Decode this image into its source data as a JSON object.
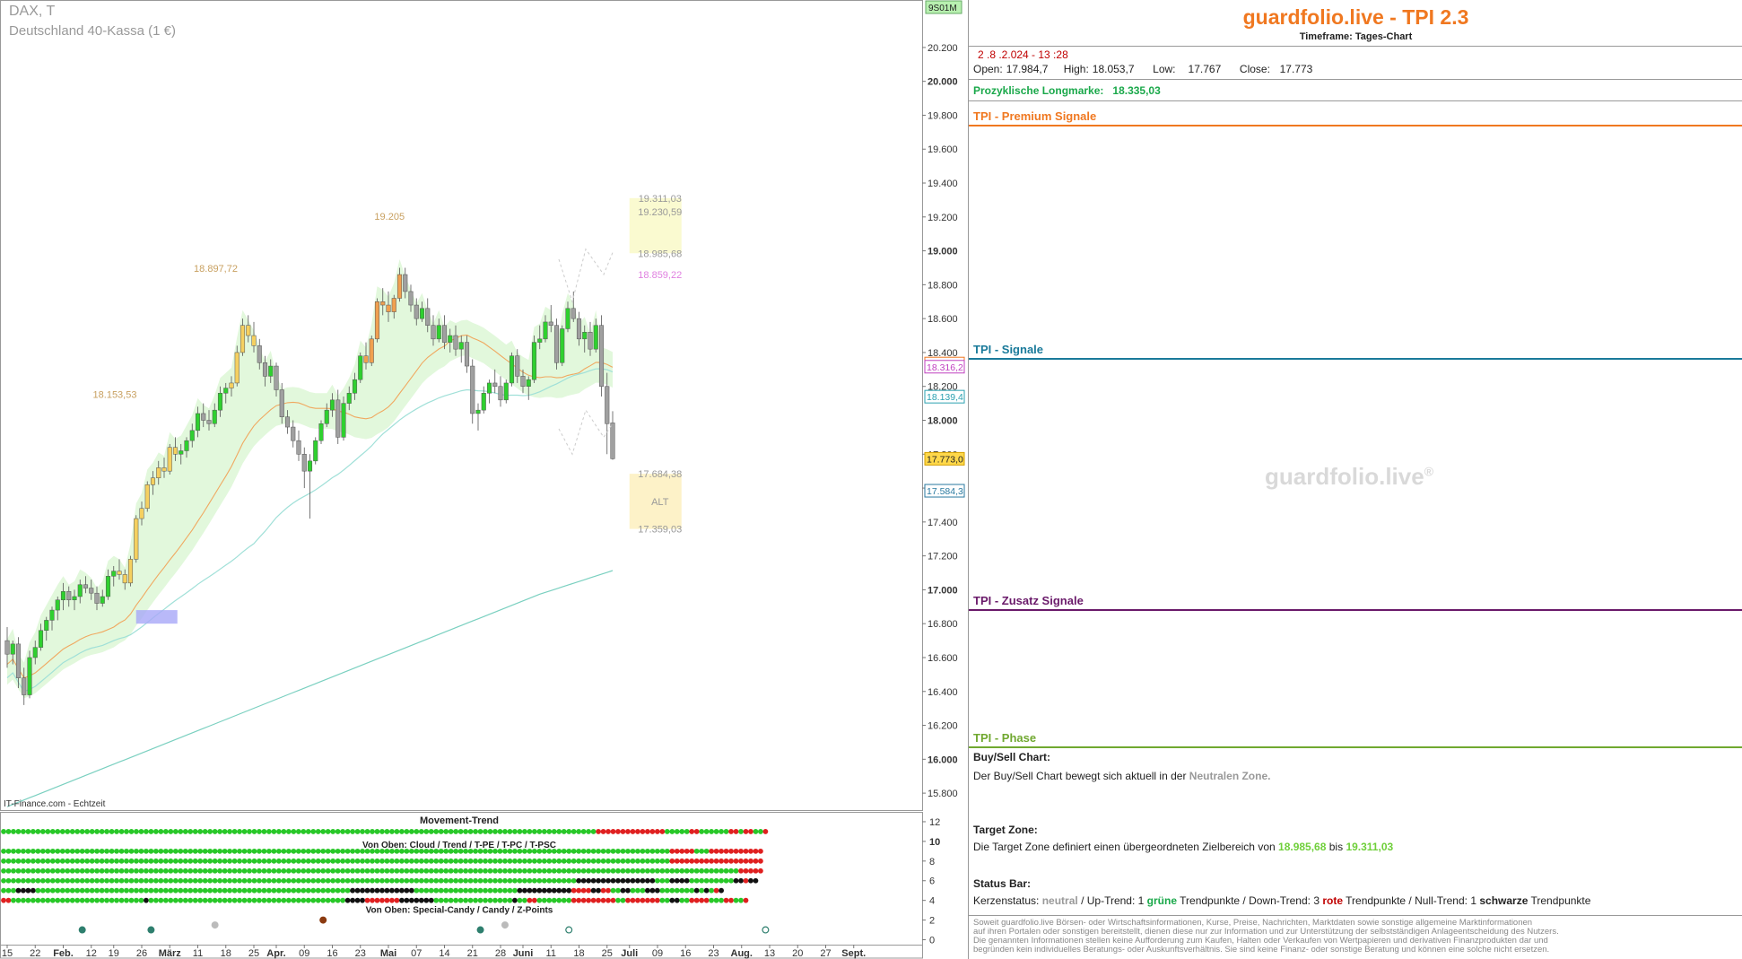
{
  "header": {
    "symbol": "DAX, T",
    "name": "Deutschland 40-Kassa (1 €)"
  },
  "source": "IT-Finance.com - Echtzeit",
  "watermark": "guardfolio.live",
  "watermark_reg": "®",
  "toolbar_label": "9S01M",
  "chart_data": [
    {
      "type": "candlestick",
      "y_axis": {
        "min": 15700,
        "max": 20480,
        "side": "right",
        "ticks": [
          "20.200",
          "20.000",
          "19.800",
          "19.600",
          "19.400",
          "19.200",
          "19.000",
          "18.800",
          "18.600",
          "18.400",
          "18.200",
          "18.000",
          "17.800",
          "17.600",
          "17.400",
          "17.200",
          "17.000",
          "16.800",
          "16.600",
          "16.400",
          "16.200",
          "16.000",
          "15.800"
        ],
        "tick_values": [
          20200,
          20000,
          19800,
          19600,
          19400,
          19200,
          19000,
          18800,
          18600,
          18400,
          18200,
          18000,
          17800,
          17600,
          17400,
          17200,
          17000,
          16800,
          16600,
          16400,
          16200,
          16000,
          15800
        ],
        "bold_ticks": [
          20000,
          19000,
          18000,
          17000,
          16000
        ]
      },
      "x_axis": {
        "labels": [
          "15",
          "22",
          "Feb.",
          "12",
          "19",
          "26",
          "März",
          "11",
          "18",
          "25",
          "Apr.",
          "09",
          "16",
          "23",
          "Mai",
          "07",
          "14",
          "21",
          "28",
          "Juni",
          "11",
          "18",
          "25",
          "Juli",
          "09",
          "16",
          "23",
          "Aug.",
          "13",
          "20",
          "27",
          "Sept."
        ],
        "label_index": [
          0,
          5,
          10,
          15,
          19,
          24,
          29,
          34,
          39,
          44,
          48,
          53,
          58,
          63,
          68,
          73,
          78,
          83,
          88,
          92,
          97,
          102,
          107,
          111,
          116,
          121,
          126,
          131,
          136,
          141,
          146,
          151
        ],
        "bold_labels": [
          "Feb.",
          "März",
          "Apr.",
          "Mai",
          "Juni",
          "Juli",
          "Aug.",
          "Sept."
        ]
      },
      "price_tags": [
        {
          "value": 18335.0,
          "label": "18.335,0",
          "color": "#f07820"
        },
        {
          "value": 18316.2,
          "label": "18.316,2",
          "color": "#c040c0"
        },
        {
          "value": 18139.4,
          "label": "18.139,4",
          "color": "#2aa0b0"
        },
        {
          "value": 17773.0,
          "label": "17.773,0",
          "color": "#d4a000"
        },
        {
          "value": 17584.3,
          "label": "17.584,3",
          "color": "#2a7aa0"
        }
      ],
      "annotations": [
        {
          "text": "18.153,53",
          "value": 18153.53,
          "index": 24,
          "color": "#c8a060"
        },
        {
          "text": "18.897,72",
          "value": 18897.72,
          "index": 42,
          "color": "#c8a060"
        },
        {
          "text": "19.205",
          "value": 19205,
          "index": 73,
          "color": "#c8a060"
        },
        {
          "text": "19.311,03",
          "value": 19311.03,
          "index": 150,
          "color": "#999999"
        },
        {
          "text": "19.230,59",
          "value": 19230.59,
          "index": 150,
          "color": "#999999"
        },
        {
          "text": "18.985,68",
          "value": 18985.68,
          "index": 150,
          "color": "#999999"
        },
        {
          "text": "18.859,22",
          "value": 18859.22,
          "index": 150,
          "color": "#e080e0"
        },
        {
          "text": "17.684,38",
          "value": 17684.38,
          "index": 150,
          "color": "#999999"
        },
        {
          "text": "17.359,03",
          "value": 17359.03,
          "index": 150,
          "color": "#999999"
        },
        {
          "text": "ALT",
          "value": 17520,
          "index": 150,
          "color": "#999999"
        }
      ],
      "target_zone": {
        "low": 18985.68,
        "high": 19311.03
      },
      "alt_zone": {
        "low": 17359.03,
        "high": 17684.38
      },
      "candles_ohlc": [
        [
          16700,
          16780,
          16540,
          16620
        ],
        [
          16620,
          16700,
          16560,
          16680
        ],
        [
          16680,
          16720,
          16420,
          16480
        ],
        [
          16480,
          16540,
          16320,
          16380
        ],
        [
          16380,
          16640,
          16360,
          16600
        ],
        [
          16600,
          16700,
          16560,
          16660
        ],
        [
          16660,
          16800,
          16640,
          16760
        ],
        [
          16760,
          16840,
          16700,
          16820
        ],
        [
          16820,
          16900,
          16760,
          16880
        ],
        [
          16880,
          16960,
          16820,
          16940
        ],
        [
          16940,
          17040,
          16880,
          16990
        ],
        [
          16990,
          17020,
          16900,
          16940
        ],
        [
          16940,
          17000,
          16880,
          16960
        ],
        [
          16960,
          17060,
          16920,
          17030
        ],
        [
          17030,
          17080,
          16980,
          17010
        ],
        [
          17010,
          17060,
          16940,
          16980
        ],
        [
          16980,
          17020,
          16880,
          16920
        ],
        [
          16920,
          17000,
          16900,
          16960
        ],
        [
          16960,
          17120,
          16940,
          17080
        ],
        [
          17080,
          17140,
          17020,
          17110
        ],
        [
          17110,
          17180,
          17060,
          17090
        ],
        [
          17090,
          17120,
          17000,
          17040
        ],
        [
          17040,
          17200,
          17020,
          17180
        ],
        [
          17180,
          17440,
          17160,
          17420
        ],
        [
          17420,
          17520,
          17380,
          17480
        ],
        [
          17480,
          17640,
          17460,
          17620
        ],
        [
          17620,
          17700,
          17560,
          17660
        ],
        [
          17660,
          17760,
          17620,
          17720
        ],
        [
          17720,
          17780,
          17660,
          17700
        ],
        [
          17700,
          17860,
          17680,
          17840
        ],
        [
          17840,
          17900,
          17760,
          17800
        ],
        [
          17800,
          17860,
          17740,
          17820
        ],
        [
          17820,
          17900,
          17780,
          17880
        ],
        [
          17880,
          17980,
          17840,
          17940
        ],
        [
          17940,
          18080,
          17900,
          18040
        ],
        [
          18040,
          18100,
          17960,
          18000
        ],
        [
          18000,
          18060,
          17940,
          17980
        ],
        [
          17980,
          18100,
          17960,
          18060
        ],
        [
          18060,
          18200,
          18020,
          18160
        ],
        [
          18160,
          18220,
          18100,
          18190
        ],
        [
          18190,
          18260,
          18140,
          18220
        ],
        [
          18220,
          18440,
          18200,
          18400
        ],
        [
          18400,
          18600,
          18380,
          18560
        ],
        [
          18560,
          18620,
          18460,
          18500
        ],
        [
          18500,
          18580,
          18400,
          18440
        ],
        [
          18440,
          18480,
          18300,
          18340
        ],
        [
          18340,
          18380,
          18200,
          18260
        ],
        [
          18260,
          18360,
          18220,
          18320
        ],
        [
          18320,
          18340,
          18140,
          18180
        ],
        [
          18180,
          18220,
          17980,
          18020
        ],
        [
          18020,
          18060,
          17920,
          17960
        ],
        [
          17960,
          18000,
          17840,
          17880
        ],
        [
          17880,
          17940,
          17760,
          17800
        ],
        [
          17800,
          17840,
          17600,
          17700
        ],
        [
          17700,
          17800,
          17420,
          17760
        ],
        [
          17760,
          17900,
          17740,
          17880
        ],
        [
          17880,
          18000,
          17860,
          17980
        ],
        [
          17980,
          18100,
          17960,
          18060
        ],
        [
          18060,
          18160,
          18020,
          18120
        ],
        [
          18120,
          18180,
          17860,
          17900
        ],
        [
          17900,
          18140,
          17880,
          18100
        ],
        [
          18100,
          18200,
          18060,
          18160
        ],
        [
          18160,
          18280,
          18120,
          18240
        ],
        [
          18240,
          18400,
          18220,
          18380
        ],
        [
          18380,
          18460,
          18300,
          18340
        ],
        [
          18340,
          18500,
          18320,
          18480
        ],
        [
          18480,
          18720,
          18460,
          18700
        ],
        [
          18700,
          18780,
          18620,
          18680
        ],
        [
          18680,
          18760,
          18580,
          18640
        ],
        [
          18640,
          18740,
          18600,
          18720
        ],
        [
          18720,
          18900,
          18700,
          18860
        ],
        [
          18860,
          18900,
          18720,
          18760
        ],
        [
          18760,
          18800,
          18640,
          18680
        ],
        [
          18680,
          18720,
          18560,
          18600
        ],
        [
          18600,
          18700,
          18580,
          18660
        ],
        [
          18660,
          18720,
          18520,
          18560
        ],
        [
          18560,
          18620,
          18440,
          18480
        ],
        [
          18480,
          18600,
          18460,
          18560
        ],
        [
          18560,
          18620,
          18420,
          18460
        ],
        [
          18460,
          18540,
          18400,
          18500
        ],
        [
          18500,
          18560,
          18380,
          18420
        ],
        [
          18420,
          18500,
          18340,
          18460
        ],
        [
          18460,
          18500,
          18280,
          18320
        ],
        [
          18320,
          18360,
          17980,
          18040
        ],
        [
          18040,
          18100,
          17940,
          18060
        ],
        [
          18060,
          18200,
          18040,
          18160
        ],
        [
          18160,
          18240,
          18100,
          18220
        ],
        [
          18220,
          18300,
          18160,
          18200
        ],
        [
          18200,
          18260,
          18080,
          18120
        ],
        [
          18120,
          18240,
          18100,
          18220
        ],
        [
          18220,
          18400,
          18200,
          18380
        ],
        [
          18380,
          18420,
          18220,
          18260
        ],
        [
          18260,
          18300,
          18160,
          18200
        ],
        [
          18200,
          18260,
          18120,
          18240
        ],
        [
          18240,
          18500,
          18220,
          18460
        ],
        [
          18460,
          18560,
          18420,
          18480
        ],
        [
          18480,
          18620,
          18460,
          18580
        ],
        [
          18580,
          18680,
          18520,
          18560
        ],
        [
          18560,
          18600,
          18300,
          18340
        ],
        [
          18340,
          18560,
          18320,
          18540
        ],
        [
          18540,
          18700,
          18520,
          18660
        ],
        [
          18660,
          18760,
          18580,
          18600
        ],
        [
          18600,
          18640,
          18440,
          18480
        ],
        [
          18480,
          18560,
          18400,
          18520
        ],
        [
          18520,
          18580,
          18380,
          18420
        ],
        [
          18420,
          18600,
          18400,
          18560
        ],
        [
          18560,
          18620,
          18140,
          18200
        ],
        [
          18200,
          18280,
          17800,
          17980
        ],
        [
          17984.7,
          18053.7,
          17767,
          17773
        ]
      ]
    },
    {
      "type": "heatmap",
      "title": "Movement-Trend",
      "row_labels": [
        "Von Oben: Cloud / Trend / T-PE / T-PC / T-PSC",
        "Von Oben: Special-Candy / Candy / Z-Points"
      ],
      "y_ticks": [
        "12",
        "10",
        "8",
        "6",
        "4",
        "2",
        "0"
      ],
      "y_tick_values": [
        12,
        10,
        8,
        6,
        4,
        2,
        0
      ],
      "rows": [
        {
          "value": 11,
          "colors": "GGGGGGGGGGGGGGGGGGGGGGGGGGGGGGGGGGGGGGGGGGGGGGGGGGGGGGGGGGGGGGGGGGGGGGGGGGGGGGGGGGGGGGGGGGGGGGGGGGGGGGGGGGGGGGGGGGGGGGGGGRRRRRRRRRRRRRRGGGGGRRGGGGGGRRGRRGGR"
        },
        {
          "value": 9,
          "colors": "GGGGGGGGGGGGGGGGGGGGGGGGGGGGGGGGGGGGGGGGGGGGGGGGGGGGGGGGGGGGGGGGGGGGGGGGGGGGGGGGGGGGGGGGGGGGGGGGGGGGGGGGGGGGGGGGGGGGGGGGGGGGGGGGGGGGGGGGRRRRRGGGRRRRRRRRRRR"
        },
        {
          "value": 8,
          "colors": "GGGGGGGGGGGGGGGGGGGGGGGGGGGGGGGGGGGGGGGGGGGGGGGGGGGGGGGGGGGGGGGGGGGGGGGGGGGGGGGGGGGGGGGGGGGGGGGGGGGGGGGGGGGGGGGGGGGGGGGGGGGGGGGGGGGGGGGGRRRRRRRRRRRRRRRRRRR"
        },
        {
          "value": 7,
          "colors": "GGGGGGGGGGGGGGGGGGGGGGGGGGGGGGGGGGGGGGGGGGGGGGGGGGGGGGGGGGGGGGGGGGGGGGGGGGGGGGGGGGGGGGGGGGGGGGGGGGGGGGGGGGGGGGGGGGGGGGGGGGGGGGGGGGGGGGGGGGGGGGGGGGGGGGRRRRR"
        },
        {
          "value": 6,
          "colors": "GGGGGGGGGGGGGGGGGGGGGGGGGGGGGGGGGGGGGGGGGGGGGGGGGGGGGGGGGGGGGGGGGGGGGGGGGGGGGGGGGGGGGGGGGGGGGGGGGGGGGGGGGGGGGGGGGGGGGKKKKKKKKKKKKKKKKGGGKKKKGGGGGGGGGKKRKK"
        },
        {
          "value": 5,
          "colors": "GGGKKKKGGGGGGGGGGGGGGGGGGGGGGGGGGGGGGGGGGGGGGGGGGGGGGGGGGGGGGGGGGGGGGGGKKKKKKKKKKKKKGGGGGGGGGGGGGGGGGGGGGKKKKKKKKKKKRRRRKKRRGGKKGGGKKKGGGGGGGKGKGRK"
        },
        {
          "value": 4,
          "colors": "RRGGGGGGGGGGGGGGGGGGGGGGGGGGGKGGGGGGGGGGGGGGGGGGGGGGGGGGGGGGGGGGGGGGGGKKKKRRRRRRRKKKKKKKGGGGGGGGGGGGGGGGKGGRRGGGGGGGRRRRRRRRRGGRRRRRRRGGKKGGRRRRGGGRRGGR"
        }
      ],
      "markers": [
        {
          "index": 16,
          "value": 1,
          "color": "#2e7f6e"
        },
        {
          "index": 30,
          "value": 1,
          "color": "#2e7f6e"
        },
        {
          "index": 43,
          "value": 1.5,
          "color": "#bbbbbb"
        },
        {
          "index": 65,
          "value": 2,
          "color": "#8b3a10"
        },
        {
          "index": 97,
          "value": 1,
          "color": "#2e7f6e"
        },
        {
          "index": 102,
          "value": 1.5,
          "color": "#bbbbbb"
        },
        {
          "index": 115,
          "value": 1,
          "color": "#2e7f6e",
          "hollow": true
        },
        {
          "index": 155,
          "value": 1,
          "color": "#2e7f6e",
          "hollow": true
        }
      ]
    }
  ],
  "info": {
    "brand": "guardfolio.live - TPI 2.3",
    "timeframe": "Timeframe: Tages-Chart",
    "datetime": "2 .8 .2.024  - 13 :28",
    "ohlc": {
      "open_label": "Open:",
      "open": "17.984,7",
      "high_label": "High:",
      "high": "18.053,7",
      "low_label": "Low:",
      "low": "17.767",
      "close_label": "Close:",
      "close": "17.773"
    },
    "longmark_label": "Prozyklische Longmarke:",
    "longmark_value": "18.335,03",
    "sections": {
      "premium": {
        "title": "TPI - Premium Signale",
        "color": "#f07820"
      },
      "signale": {
        "title": "TPI - Signale",
        "color": "#1a7a9a"
      },
      "zusatz": {
        "title": "TPI - Zusatz Signale",
        "color": "#6a1a6a"
      },
      "phase": {
        "title": "TPI - Phase",
        "color": "#70a830"
      }
    },
    "buysell": {
      "title": "Buy/Sell Chart:",
      "text_pre": "Der Buy/Sell Chart bewegt sich aktuell in der",
      "zone": "Neutralen Zone."
    },
    "target": {
      "title": "Target Zone:",
      "text_pre": "Die Target Zone definiert einen übergeordneten Zielbereich von",
      "low": "18.985,68",
      "mid": "bis",
      "high": "19.311,03"
    },
    "status": {
      "title": "Status Bar:",
      "k1": "Kerzenstatus:",
      "k2": "neutral",
      "k3": "/ Up-Trend: 1",
      "k4": "grüne",
      "k5": "Trendpunkte  / Down-Trend: 3",
      "k6": "rote",
      "k7": "Trendpunkte / Null-Trend: 1",
      "k8": "schwarze",
      "k9": "Trendpunkte"
    },
    "disclaimer": [
      "Soweit guardfolio.live Börsen- oder Wirtschaftsinformationen, Kurse, Preise, Nachrichten, Marktdaten sowie sonstige allgemeine Marktinformationen",
      "auf ihren Portalen oder sonstigen bereitstellt, dienen diese nur zur Information und zur Unterstützung der selbstständigen Anlageentscheidung des Nutzers.",
      "Die genannten Informationen stellen keine Aufforderung zum Kaufen, Halten oder Verkaufen von Wertpapieren und derivativen Finanzprodukten dar und",
      "begründen kein individuelles Beratungs- oder Auskunftsverhältnis. Sie sind keine Finanz- oder sonstige Beratung und können eine solche nicht ersetzen."
    ]
  },
  "colors": {
    "bull": "#2fd02f",
    "bear": "#a0a0a0",
    "orange_candle": "#f0a050",
    "yellow_candle": "#f5d060",
    "cloud": "#d8f5d0",
    "ma_orange": "#f0a860",
    "ma_teal": "#7ad0c0",
    "ma_teal2": "#a0e0d8",
    "dot_green": "#28c828",
    "dot_red": "#e02020",
    "dot_black": "#111111"
  }
}
